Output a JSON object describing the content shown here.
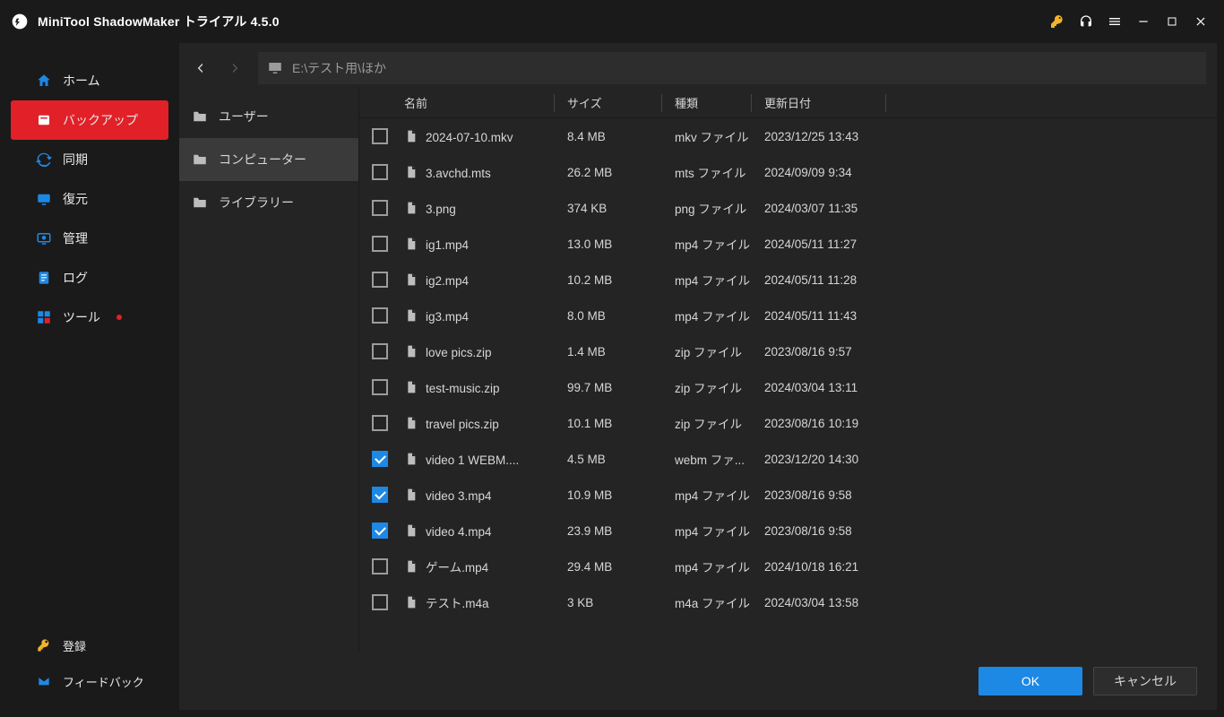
{
  "title": "MiniTool ShadowMaker トライアル 4.5.0",
  "sidebar": {
    "items": [
      {
        "icon": "home",
        "label": "ホーム"
      },
      {
        "icon": "backup",
        "label": "バックアップ"
      },
      {
        "icon": "sync",
        "label": "同期"
      },
      {
        "icon": "restore",
        "label": "復元"
      },
      {
        "icon": "manage",
        "label": "管理"
      },
      {
        "icon": "log",
        "label": "ログ"
      },
      {
        "icon": "tools",
        "label": "ツール"
      }
    ],
    "footer": [
      {
        "icon": "key",
        "label": "登録"
      },
      {
        "icon": "feedback",
        "label": "フィードバック"
      }
    ],
    "active_index": 1,
    "new_badge_index": 6
  },
  "pathbar": {
    "path": "E:\\テスト用\\ほか"
  },
  "tree": {
    "items": [
      {
        "label": "ユーザー"
      },
      {
        "label": "コンピューター"
      },
      {
        "label": "ライブラリー"
      }
    ],
    "active_index": 1
  },
  "columns": {
    "name": "名前",
    "size": "サイズ",
    "type": "種類",
    "date": "更新日付"
  },
  "files": [
    {
      "checked": false,
      "name": "2024-07-10.mkv",
      "size": "8.4 MB",
      "type": "mkv ファイル",
      "date": "2023/12/25 13:43"
    },
    {
      "checked": false,
      "name": "3.avchd.mts",
      "size": "26.2 MB",
      "type": "mts ファイル",
      "date": "2024/09/09 9:34"
    },
    {
      "checked": false,
      "name": "3.png",
      "size": "374 KB",
      "type": "png ファイル",
      "date": "2024/03/07 11:35"
    },
    {
      "checked": false,
      "name": "ig1.mp4",
      "size": "13.0 MB",
      "type": "mp4 ファイル",
      "date": "2024/05/11 11:27"
    },
    {
      "checked": false,
      "name": "ig2.mp4",
      "size": "10.2 MB",
      "type": "mp4 ファイル",
      "date": "2024/05/11 11:28"
    },
    {
      "checked": false,
      "name": "ig3.mp4",
      "size": "8.0 MB",
      "type": "mp4 ファイル",
      "date": "2024/05/11 11:43"
    },
    {
      "checked": false,
      "name": "love pics.zip",
      "size": "1.4 MB",
      "type": "zip ファイル",
      "date": "2023/08/16 9:57"
    },
    {
      "checked": false,
      "name": "test-music.zip",
      "size": "99.7 MB",
      "type": "zip ファイル",
      "date": "2024/03/04 13:11"
    },
    {
      "checked": false,
      "name": "travel pics.zip",
      "size": "10.1 MB",
      "type": "zip ファイル",
      "date": "2023/08/16 10:19"
    },
    {
      "checked": true,
      "name": "video 1 WEBM....",
      "size": "4.5 MB",
      "type": "webm ファ...",
      "date": "2023/12/20 14:30"
    },
    {
      "checked": true,
      "name": "video 3.mp4",
      "size": "10.9 MB",
      "type": "mp4 ファイル",
      "date": "2023/08/16 9:58"
    },
    {
      "checked": true,
      "name": "video 4.mp4",
      "size": "23.9 MB",
      "type": "mp4 ファイル",
      "date": "2023/08/16 9:58"
    },
    {
      "checked": false,
      "name": "ゲーム.mp4",
      "size": "29.4 MB",
      "type": "mp4 ファイル",
      "date": "2024/10/18 16:21"
    },
    {
      "checked": false,
      "name": "テスト.m4a",
      "size": "3 KB",
      "type": "m4a ファイル",
      "date": "2024/03/04 13:58"
    }
  ],
  "buttons": {
    "ok": "OK",
    "cancel": "キャンセル"
  }
}
